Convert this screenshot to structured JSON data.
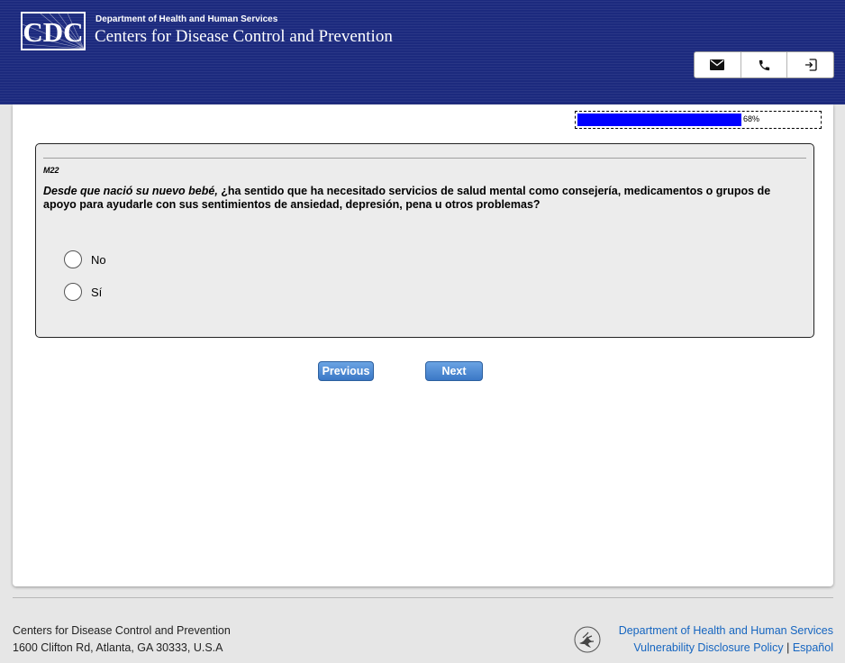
{
  "header": {
    "logo_text": "CDC",
    "department": "Department of Health and Human Services",
    "agency": "Centers for Disease Control and Prevention",
    "buttons": [
      {
        "name": "email",
        "icon": "envelope-icon"
      },
      {
        "name": "phone",
        "icon": "phone-icon"
      },
      {
        "name": "exit",
        "icon": "exit-icon"
      }
    ]
  },
  "progress": {
    "percent": 68,
    "label": "68%",
    "fill_color": "#0000ff"
  },
  "question": {
    "id": "M22",
    "text_italic": "Desde que nació su nuevo bebé,",
    "text_rest": " ¿ha sentido que ha necesitado servicios de salud mental como consejería, medicamentos o grupos de apoyo para ayudarle con sus sentimientos de ansiedad, depresión, pena u otros problemas?",
    "options": [
      {
        "label": "No",
        "selected": false
      },
      {
        "label": "Sí",
        "selected": false
      }
    ]
  },
  "nav": {
    "previous_label": "Previous",
    "next_label": "Next"
  },
  "footer": {
    "org_name": "Centers for Disease Control and Prevention",
    "address": "1600 Clifton Rd, Atlanta, GA 30333, U.S.A",
    "hhs_link": "Department of Health and Human Services",
    "vdp_link": "Vulnerability Disclosure Policy",
    "separator": "|",
    "espanol_link": "Español"
  },
  "colors": {
    "header_bg": "#1c2a7e",
    "button_blue": "#3b78c6",
    "link_blue": "#1565c0"
  }
}
